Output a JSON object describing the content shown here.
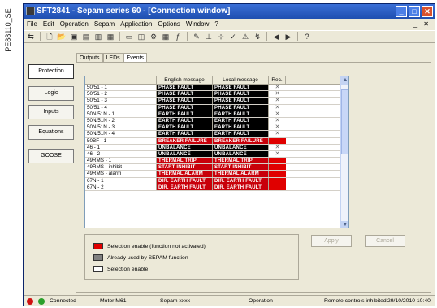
{
  "side_label": "PE88110_SE",
  "window": {
    "title": "SFT2841 - Sepam series 60 - [Connection window]",
    "controls": [
      "_",
      "□",
      "✕"
    ]
  },
  "menu": [
    "File",
    "Edit",
    "Operation",
    "Sepam",
    "Application",
    "Options",
    "Window",
    "?"
  ],
  "mdi_controls": "_ ✕",
  "nav": [
    "Protection",
    "Logic",
    "Inputs",
    "Equations",
    "GOOSE"
  ],
  "tabs": [
    "Outputs",
    "LEDs",
    "Events"
  ],
  "grid": {
    "headers": [
      "",
      "English message",
      "Local message",
      "Rec."
    ],
    "rows": [
      {
        "name": "50/51 - 1",
        "en": "PHASE FAULT",
        "local": "PHASE FAULT",
        "rec": "✕",
        "state": "enabled"
      },
      {
        "name": "50/51 - 2",
        "en": "PHASE FAULT",
        "local": "PHASE FAULT",
        "rec": "✕",
        "state": "enabled"
      },
      {
        "name": "50/51 - 3",
        "en": "PHASE FAULT",
        "local": "PHASE FAULT",
        "rec": "✕",
        "state": "enabled"
      },
      {
        "name": "50/51 - 4",
        "en": "PHASE FAULT",
        "local": "PHASE FAULT",
        "rec": "✕",
        "state": "enabled"
      },
      {
        "name": "50N/51N - 1",
        "en": "EARTH FAULT",
        "local": "EARTH FAULT",
        "rec": "✕",
        "state": "enabled"
      },
      {
        "name": "50N/51N - 2",
        "en": "EARTH FAULT",
        "local": "EARTH FAULT",
        "rec": "✕",
        "state": "enabled"
      },
      {
        "name": "50N/51N - 3",
        "en": "EARTH FAULT",
        "local": "EARTH FAULT",
        "rec": "✕",
        "state": "enabled"
      },
      {
        "name": "50N/51N - 4",
        "en": "EARTH FAULT",
        "local": "EARTH FAULT",
        "rec": "✕",
        "state": "enabled"
      },
      {
        "name": "50BF - 1",
        "en": "BREAKER FAILURE",
        "local": "BREAKER FAILURE",
        "rec": "",
        "state": "not_activated"
      },
      {
        "name": "46 - 1",
        "en": "UNBALANCE I",
        "local": "UNBALANCE I",
        "rec": "✕",
        "state": "enabled"
      },
      {
        "name": "46 - 2",
        "en": "UNBALANCE I",
        "local": "UNBALANCE I",
        "rec": "✕",
        "state": "enabled"
      },
      {
        "name": "49RMS - 1",
        "en": "THERMAL TRIP",
        "local": "THERMAL TRIP",
        "rec": "",
        "state": "not_activated"
      },
      {
        "name": "49RMS - inhibit",
        "en": "START INHIBIT",
        "local": "START INHIBIT",
        "rec": "",
        "state": "not_activated"
      },
      {
        "name": "49RMS - alarm",
        "en": "THERMAL ALARM",
        "local": "THERMAL ALARM",
        "rec": "",
        "state": "not_activated"
      },
      {
        "name": "67N - 1",
        "en": "DIR. EARTH FAULT",
        "local": "DIR. EARTH FAULT",
        "rec": "✕",
        "state": "not_activated"
      },
      {
        "name": "67N - 2",
        "en": "DIR. EARTH FAULT",
        "local": "DIR. EARTH FAULT",
        "rec": "✕",
        "state": "not_activated"
      }
    ]
  },
  "legend": [
    {
      "label": "Selection enable (function not activated)",
      "color": "#e00000"
    },
    {
      "label": "Already used by SEPAM function",
      "color": "#808080"
    },
    {
      "label": "Selection enable",
      "color": "#ffffff"
    }
  ],
  "buttons": {
    "apply": "Apply",
    "cancel": "Cancel"
  },
  "status": {
    "connected": "Connected",
    "motor": "Motor M61",
    "sepam": "Sepam xxxx",
    "mode": "Operation",
    "remote": "Remote controls inhibited",
    "datetime": "29/10/2010 10:40"
  },
  "colors": {
    "title_bar": "#1f4fb0",
    "not_activated": "#e00000",
    "used": "#808080"
  }
}
